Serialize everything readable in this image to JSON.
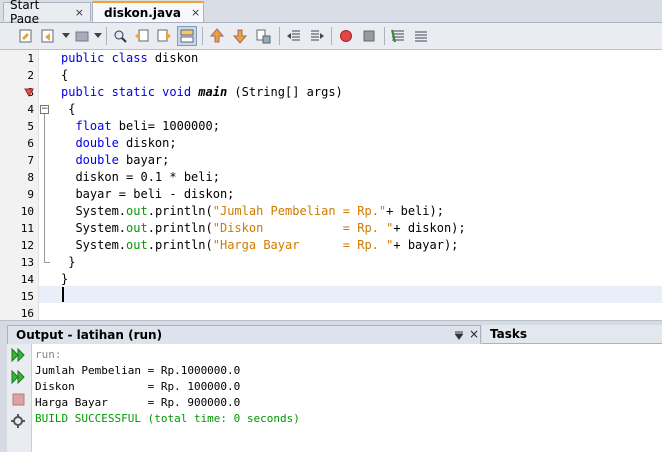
{
  "tabs": [
    {
      "label": "Start Page",
      "close": "×"
    },
    {
      "label": "diskon.java",
      "close": "×"
    }
  ],
  "toolbar": {
    "buttons": [
      "last-edit-icon",
      "back-icon",
      "forward-icon",
      "find-icon",
      "find-previous-icon",
      "find-next-icon",
      "toggle-highlight-icon",
      "previous-bookmark-icon",
      "next-bookmark-icon",
      "toggle-bookmark-icon",
      "shift-left-icon",
      "shift-right-icon",
      "record-macro-icon",
      "stop-macro-icon",
      "comment-icon",
      "uncomment-icon"
    ]
  },
  "editor": {
    "line_numbers": [
      "1",
      "2",
      "3",
      "4",
      "5",
      "6",
      "7",
      "8",
      "9",
      "10",
      "11",
      "12",
      "13",
      "14",
      "15",
      "16"
    ],
    "lines": [
      [
        {
          "t": "public class ",
          "c": "kw"
        },
        {
          "t": "diskon",
          "c": ""
        }
      ],
      [
        {
          "t": "{",
          "c": ""
        }
      ],
      [
        {
          "t": "public static void ",
          "c": "kw"
        },
        {
          "t": "main",
          "c": "it"
        },
        {
          "t": " (String[] args)",
          "c": ""
        }
      ],
      [
        {
          "t": " {",
          "c": ""
        }
      ],
      [
        {
          "t": "  float",
          "c": "kw"
        },
        {
          "t": " beli= 1000000;",
          "c": ""
        }
      ],
      [
        {
          "t": "  double",
          "c": "kw"
        },
        {
          "t": " diskon;",
          "c": ""
        }
      ],
      [
        {
          "t": "  double",
          "c": "kw"
        },
        {
          "t": " bayar;",
          "c": ""
        }
      ],
      [
        {
          "t": "  diskon = 0.1 * beli;",
          "c": ""
        }
      ],
      [
        {
          "t": "  bayar = beli - diskon;",
          "c": ""
        }
      ],
      [
        {
          "t": "  System.",
          "c": ""
        },
        {
          "t": "out",
          "c": "fld"
        },
        {
          "t": ".println(",
          "c": ""
        },
        {
          "t": "\"Jumlah Pembelian = Rp.\"",
          "c": "str"
        },
        {
          "t": "+ beli);",
          "c": ""
        }
      ],
      [
        {
          "t": "  System.",
          "c": ""
        },
        {
          "t": "out",
          "c": "fld"
        },
        {
          "t": ".println(",
          "c": ""
        },
        {
          "t": "\"Diskon           = Rp. \"",
          "c": "str"
        },
        {
          "t": "+ diskon);",
          "c": ""
        }
      ],
      [
        {
          "t": "  System.",
          "c": ""
        },
        {
          "t": "out",
          "c": "fld"
        },
        {
          "t": ".println(",
          "c": ""
        },
        {
          "t": "\"Harga Bayar      = Rp. \"",
          "c": "str"
        },
        {
          "t": "+ bayar);",
          "c": ""
        }
      ],
      [
        {
          "t": " }",
          "c": ""
        }
      ],
      [
        {
          "t": "}",
          "c": ""
        }
      ],
      [
        {
          "t": "",
          "c": ""
        }
      ],
      [
        {
          "t": "",
          "c": ""
        }
      ]
    ]
  },
  "output": {
    "title": "Output - latihan (run)",
    "lines": [
      "run:",
      "Jumlah Pembelian = Rp.1000000.0",
      "Diskon           = Rp. 100000.0",
      "Harga Bayar      = Rp. 900000.0",
      "BUILD SUCCESSFUL (total time: 0 seconds)"
    ],
    "close": "×"
  },
  "tasks": {
    "label": "Tasks"
  },
  "colors": {
    "keyword": "#0000e6",
    "string": "#ce7b00",
    "field": "#009900",
    "success": "#009900",
    "active_tab_accent": "#f0a32f"
  }
}
